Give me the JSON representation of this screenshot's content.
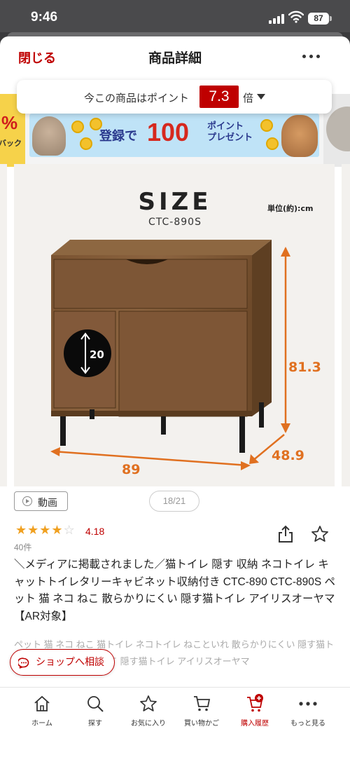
{
  "status_bar": {
    "time": "9:46",
    "battery": "87"
  },
  "header": {
    "close_label": "閉じる",
    "title": "商品詳細"
  },
  "points": {
    "prefix": "今この商品はポイント",
    "multiplier": "7.3",
    "suffix": "倍"
  },
  "banner": {
    "left_percent": "%",
    "left_text": "バック",
    "main_text_1": "登録で",
    "main_text_2": "100",
    "main_text_3a": "ポイント",
    "main_text_3b": "プレゼント"
  },
  "image": {
    "size_title": "SIZE",
    "model": "CTC-890S",
    "unit": "単位(約):cm",
    "hole": "20",
    "height": "81.3",
    "depth": "48.9",
    "width": "89"
  },
  "video_label": "動画",
  "pager": "18/21",
  "rating": {
    "value": "4.18",
    "stars": 4,
    "reviews": "40件"
  },
  "product": {
    "title": "＼メディアに掲載されました／猫トイレ 隠す 収納 ネコトイレ キャットトイレタリーキャビネット収納付き CTC-890 CTC-890S ペット 猫 ネコ ねこ 散らかりにくい 隠す猫トイレ アイリスオーヤマ 【AR対象】",
    "subtitle": "ペット 猫 ネコ ねこ 猫トイレ ネコトイレ ねこといれ 散らかりにくい 隠す猫トイレ キャット Cat ＣＡＴ 隠す猫トイレ アイリスオーヤマ"
  },
  "consult_label": "ショップへ相談",
  "nav": {
    "home": "ホーム",
    "search": "探す",
    "favorites": "お気に入り",
    "cart": "買い物かご",
    "history": "購入履歴",
    "more": "もっと見る"
  },
  "colors": {
    "accent": "#bf0000",
    "dimension": "#e07020",
    "star": "#f0a020"
  }
}
